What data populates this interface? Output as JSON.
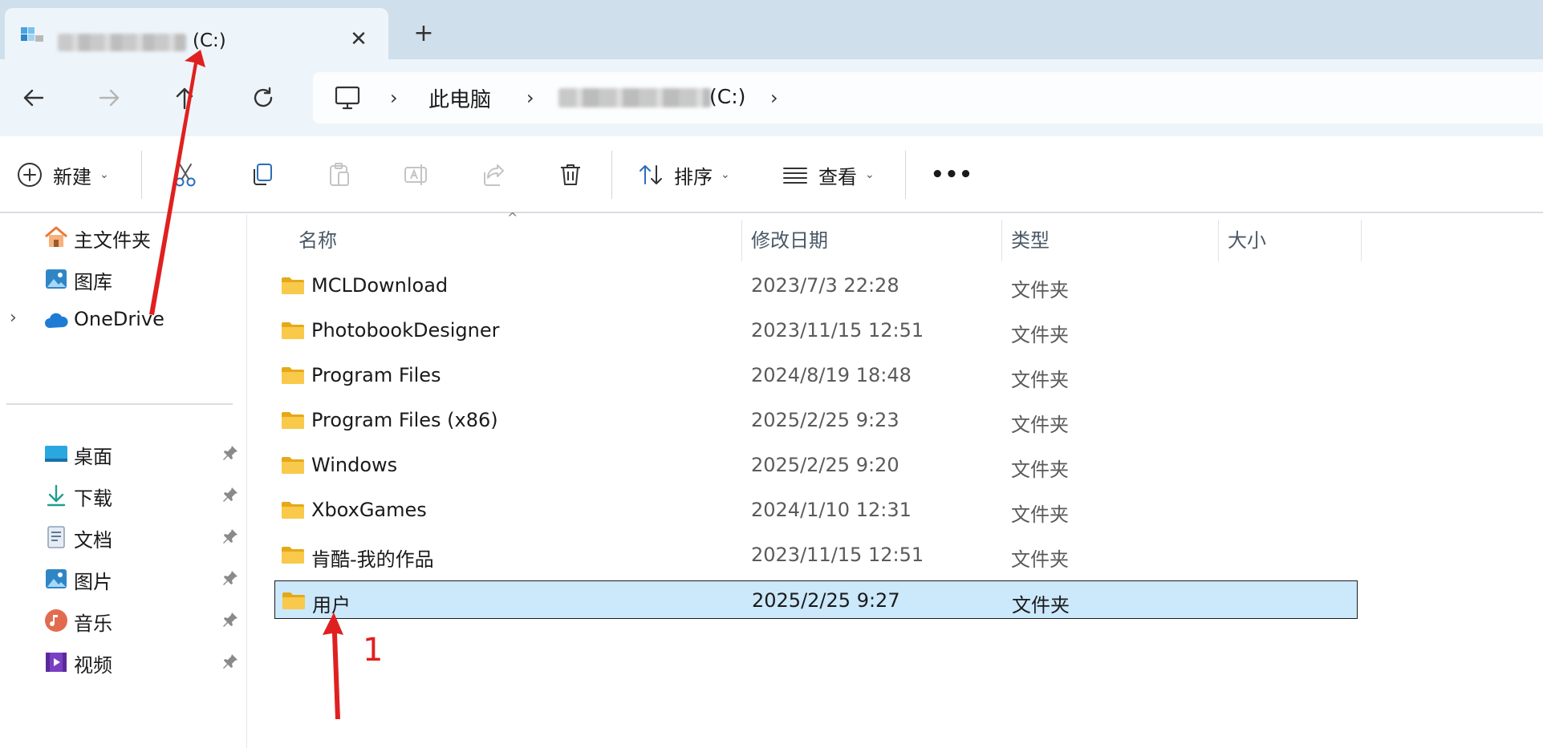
{
  "tab": {
    "title": "(C:)",
    "close_icon": "close-icon",
    "new_tab_label": "+"
  },
  "nav": {
    "back_icon": "arrow-left-icon",
    "forward_icon": "arrow-right-icon",
    "up_icon": "arrow-up-icon",
    "refresh_icon": "refresh-icon"
  },
  "breadcrumb": {
    "pc_label": "此电脑",
    "drive_label": "(C:)",
    "separator": "›"
  },
  "toolbar": {
    "new_label": "新建",
    "sort_label": "排序",
    "view_label": "查看",
    "more_label": "•••",
    "caret": "⌄"
  },
  "sidebar": {
    "expand_glyph": "›",
    "top_items": [
      {
        "label": "主文件夹",
        "icon": "home-icon"
      },
      {
        "label": "图库",
        "icon": "gallery-icon"
      },
      {
        "label": "OneDrive",
        "icon": "cloud-icon"
      }
    ],
    "pinned_items": [
      {
        "label": "桌面",
        "icon": "desktop-icon"
      },
      {
        "label": "下载",
        "icon": "download-icon"
      },
      {
        "label": "文档",
        "icon": "document-icon"
      },
      {
        "label": "图片",
        "icon": "pictures-icon"
      },
      {
        "label": "音乐",
        "icon": "music-icon"
      },
      {
        "label": "视频",
        "icon": "video-icon"
      }
    ]
  },
  "columns": {
    "name": "名称",
    "modified": "修改日期",
    "type": "类型",
    "size": "大小",
    "sort_glyph": "^"
  },
  "files": [
    {
      "name": "MCLDownload",
      "modified": "2023/7/3 22:28",
      "type": "文件夹",
      "selected": false
    },
    {
      "name": "PhotobookDesigner",
      "modified": "2023/11/15 12:51",
      "type": "文件夹",
      "selected": false
    },
    {
      "name": "Program Files",
      "modified": "2024/8/19 18:48",
      "type": "文件夹",
      "selected": false
    },
    {
      "name": "Program Files (x86)",
      "modified": "2025/2/25 9:23",
      "type": "文件夹",
      "selected": false
    },
    {
      "name": "Windows",
      "modified": "2025/2/25 9:20",
      "type": "文件夹",
      "selected": false
    },
    {
      "name": "XboxGames",
      "modified": "2024/1/10 12:31",
      "type": "文件夹",
      "selected": false
    },
    {
      "name": "肯酷-我的作品",
      "modified": "2023/11/15 12:51",
      "type": "文件夹",
      "selected": false
    },
    {
      "name": "用户",
      "modified": "2025/2/25 9:27",
      "type": "文件夹",
      "selected": true
    }
  ],
  "annotation": {
    "step_number": "1",
    "color": "#e02020"
  },
  "colors": {
    "tabbar": "#cfe0ec",
    "selection": "#cce8fb",
    "folder": "#f8c94a",
    "accent": "#0067c0"
  }
}
